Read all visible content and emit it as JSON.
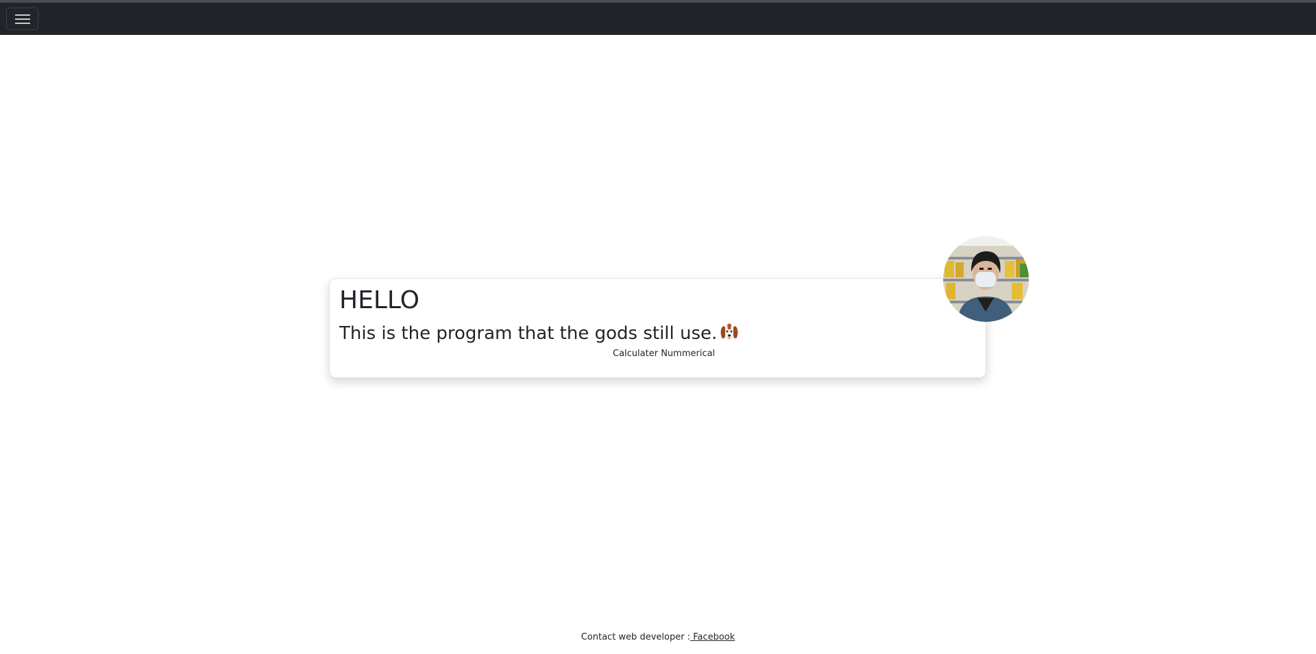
{
  "navbar": {
    "toggler_icon": "hamburger-menu-icon"
  },
  "card": {
    "heading": "HELLO",
    "subtitle": "This is the program that the gods still use.",
    "subtitle_icon": "dog-face-icon",
    "caption": "Calculater Nummerical"
  },
  "avatar": {
    "icon": "profile-photo"
  },
  "footer": {
    "text": "Contact web developer :",
    "link_label": " Facebook"
  },
  "colors": {
    "navbar_bg": "#212529",
    "page_bg": "#ffffff",
    "text": "#212529"
  }
}
